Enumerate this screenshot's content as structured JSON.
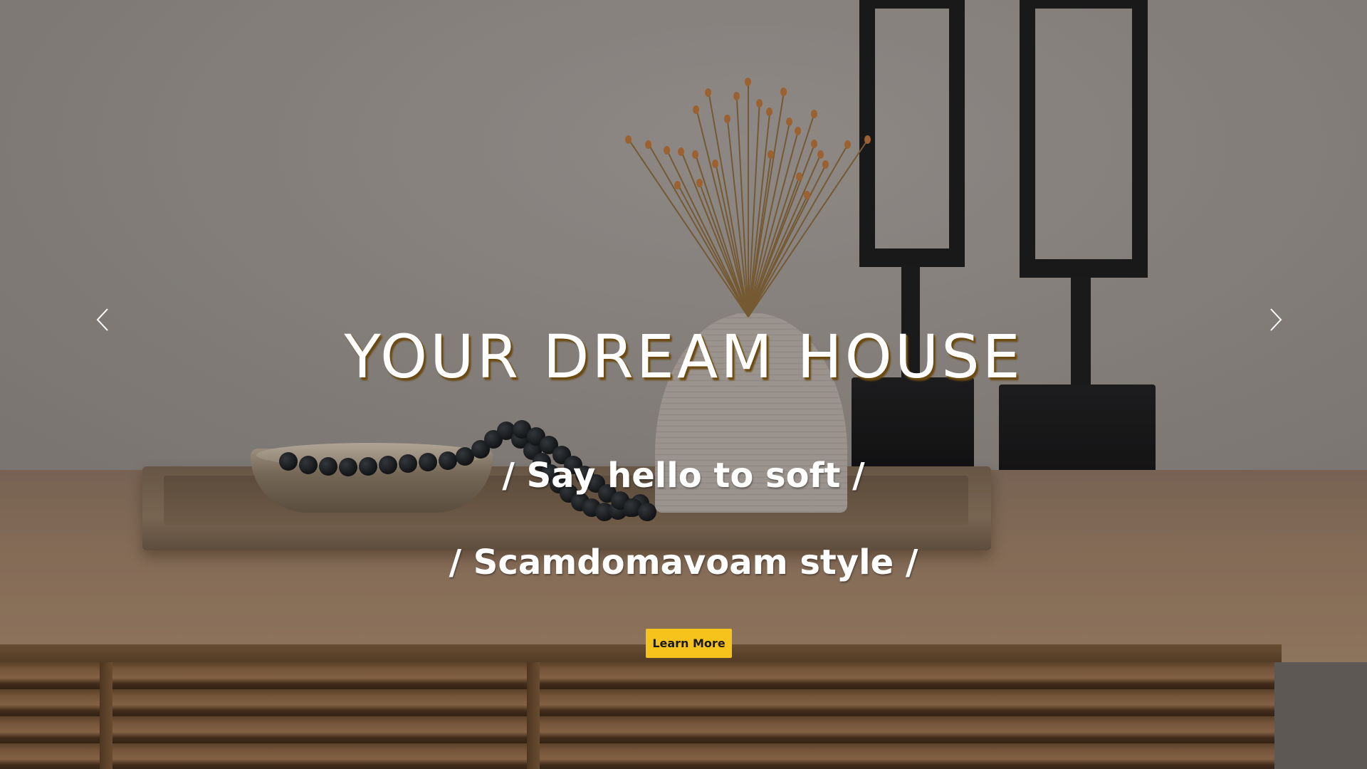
{
  "hero": {
    "title": "YOUR DREAM HOUSE",
    "subtitle_1": "/ Say hello to soft /",
    "subtitle_2": "/ Scamdomavoam style /",
    "cta_label": "Learn More"
  },
  "carousel": {
    "prev_icon": "chevron-left-icon",
    "next_icon": "chevron-right-icon"
  },
  "colors": {
    "accent": "#f6c21c",
    "title_shadow": "#8b6215",
    "text": "#ffffff"
  }
}
